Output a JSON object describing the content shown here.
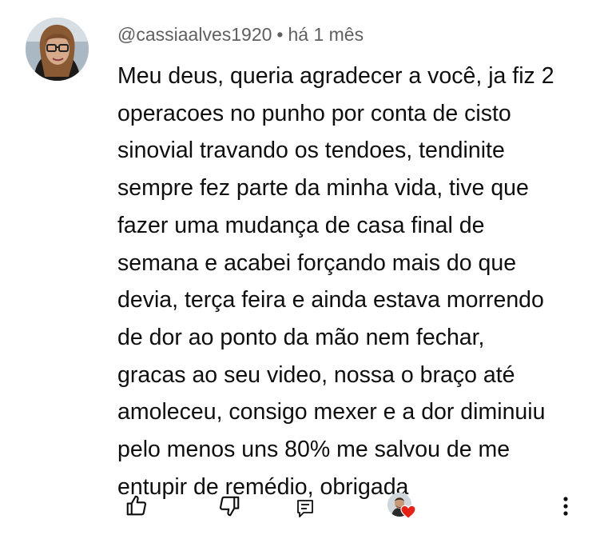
{
  "comment": {
    "author": "@cassiaalves1920",
    "separator": "•",
    "time": "há 1 mês",
    "lines": [
      "Meu deus, queria agradecer a você, ja fiz 2",
      "operacoes no punho por conta de cisto",
      "sinovial travando os tendoes, tendinite",
      "sempre fez parte da minha vida, tive que",
      "fazer uma mudança de casa final de",
      "semana e acabei forçando mais do que",
      "devia, terça feira e ainda estava morrendo",
      "de dor ao ponto da mão nem fechar,",
      "gracas ao seu video, nossa o braço até",
      "amoleceu, consigo mexer e a dor diminuiu",
      "pelo menos uns 80% me salvou de me",
      "entupir de remédio, obrigada"
    ]
  },
  "icons": {
    "avatar": "user-avatar",
    "like": "thumbs-up-icon",
    "dislike": "thumbs-down-icon",
    "reply": "reply-comment-icon",
    "creator_heart": "creator-heart-icon",
    "more": "more-vertical-icon"
  },
  "colors": {
    "text": "#0f0f0f",
    "meta": "#606060",
    "heart": "#e62117"
  }
}
